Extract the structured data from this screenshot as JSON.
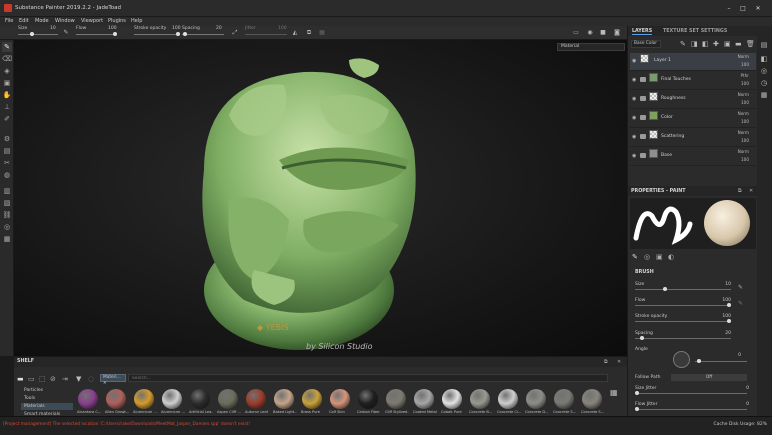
{
  "window": {
    "title": "Substance Painter 2019.2.2 - JadeToad",
    "minimize": "–",
    "maximize": "□",
    "close": "✕"
  },
  "menu": [
    "File",
    "Edit",
    "Mode",
    "Window",
    "Viewport",
    "Plugins",
    "Help"
  ],
  "tool_options": {
    "size_label": "Size",
    "size_value": "10",
    "flow_label": "Flow",
    "flow_value": "100",
    "stroke_label": "Stroke opacity",
    "stroke_value": "100",
    "spacing_label": "Spacing",
    "spacing_value": "20",
    "jitter_label": "Jitter",
    "jitter_value": "100"
  },
  "viewport": {
    "material_select": "Material",
    "logo_text": "YEBIS",
    "logo_by": "by Silicon Studio"
  },
  "layers_panel": {
    "tab_layers": "LAYERS",
    "tab_texture_set": "TEXTURE SET SETTINGS",
    "channel": "Base Color",
    "layers": [
      {
        "name": "Layer 1",
        "blend": "Norm",
        "opacity": "100",
        "type": "paint"
      },
      {
        "name": "Final Touches",
        "blend": "Pthr",
        "opacity": "100",
        "type": "folder"
      },
      {
        "name": "Roughness",
        "blend": "Norm",
        "opacity": "100",
        "type": "folder"
      },
      {
        "name": "Color",
        "blend": "Norm",
        "opacity": "100",
        "type": "folder"
      },
      {
        "name": "Scattering",
        "blend": "Norm",
        "opacity": "100",
        "type": "folder"
      },
      {
        "name": "Base",
        "blend": "Norm",
        "opacity": "100",
        "type": "folder"
      }
    ]
  },
  "properties": {
    "title": "PROPERTIES - PAINT",
    "section": "BRUSH",
    "size_label": "Size",
    "size_value": "10",
    "size_level": 0.3,
    "flow_label": "Flow",
    "flow_value": "100",
    "flow_level": 1.0,
    "stroke_label": "Stroke opacity",
    "stroke_value": "100",
    "stroke_level": 1.0,
    "spacing_label": "Spacing",
    "spacing_value": "20",
    "spacing_level": 0.05,
    "angle_label": "Angle",
    "angle_value": "0",
    "follow_path_label": "Follow Path",
    "follow_path_value": "Off",
    "size_jitter_label": "Size Jitter",
    "size_jitter_value": "0",
    "flow_jitter_label": "Flow Jitter",
    "flow_jitter_value": "0"
  },
  "shelf": {
    "title": "SHELF",
    "filter_chip": "Materi...",
    "search_placeholder": "Search...",
    "categories": [
      "Particles",
      "Tools",
      "Materials",
      "Smart materials"
    ],
    "materials": [
      {
        "name": "Alcantara C...",
        "color": "#8a3f8f"
      },
      {
        "name": "Alien Growt...",
        "color": "#b0605a"
      },
      {
        "name": "Aluminium ...",
        "color": "#d59b2c"
      },
      {
        "name": "Aluminium ...",
        "color": "#cfcfcf"
      },
      {
        "name": "Artificial Lea...",
        "color": "#2b2b2b"
      },
      {
        "name": "Aspen Cliff ...",
        "color": "#6b6e5a"
      },
      {
        "name": "Autumn Leaf",
        "color": "#9c3c2a"
      },
      {
        "name": "Baked Light...",
        "color": "#c4a58a"
      },
      {
        "name": "Brass Pure",
        "color": "#c9a23a"
      },
      {
        "name": "Calf Skin",
        "color": "#d4957a"
      },
      {
        "name": "Carbon Fiber",
        "color": "#1f1f1f"
      },
      {
        "name": "Cliff Stylized...",
        "color": "#7d7a70"
      },
      {
        "name": "Coated Metal",
        "color": "#a7a7a7"
      },
      {
        "name": "Cobalt Pure",
        "color": "#e3e3e6"
      },
      {
        "name": "Concrete B...",
        "color": "#9a9890"
      },
      {
        "name": "Concrete Cl...",
        "color": "#cfcfcf"
      },
      {
        "name": "Concrete D...",
        "color": "#8d8d88"
      },
      {
        "name": "Concrete S...",
        "color": "#7a7a74"
      },
      {
        "name": "Concrete S...",
        "color": "#88857c"
      }
    ]
  },
  "status": {
    "message": "[Project management] The selected location 'C:/Users/rake/Downloads/MeetMat_Jasper_Damien.spp' doesn't exist!",
    "cache": "Cache Disk Usage:  82%"
  }
}
